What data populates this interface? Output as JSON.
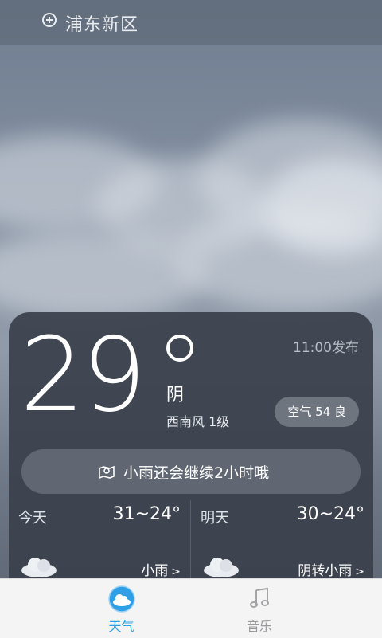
{
  "header": {
    "location": "浦东新区",
    "location_icon": "add-location-icon"
  },
  "weather": {
    "temperature": "29",
    "condition": "阴",
    "wind": "西南风 1级",
    "published": "11:00发布",
    "air_quality": "空气 54 良",
    "alert": "小雨还会继续2小时哦"
  },
  "forecast": [
    {
      "label": "今天",
      "temp": "31~24°",
      "condition": "小雨",
      "icon": "cloud-icon"
    },
    {
      "label": "明天",
      "temp": "30~24°",
      "condition": "阴转小雨",
      "icon": "cloud-icon"
    }
  ],
  "tabs": [
    {
      "label": "天气",
      "icon": "weather-cloud-icon",
      "active": true,
      "color": "#2fa0e6"
    },
    {
      "label": "音乐",
      "icon": "music-note-icon",
      "active": false,
      "color": "#9a9a9c"
    }
  ],
  "colors": {
    "accent": "#2fa0e6",
    "card": "#3a404b"
  }
}
